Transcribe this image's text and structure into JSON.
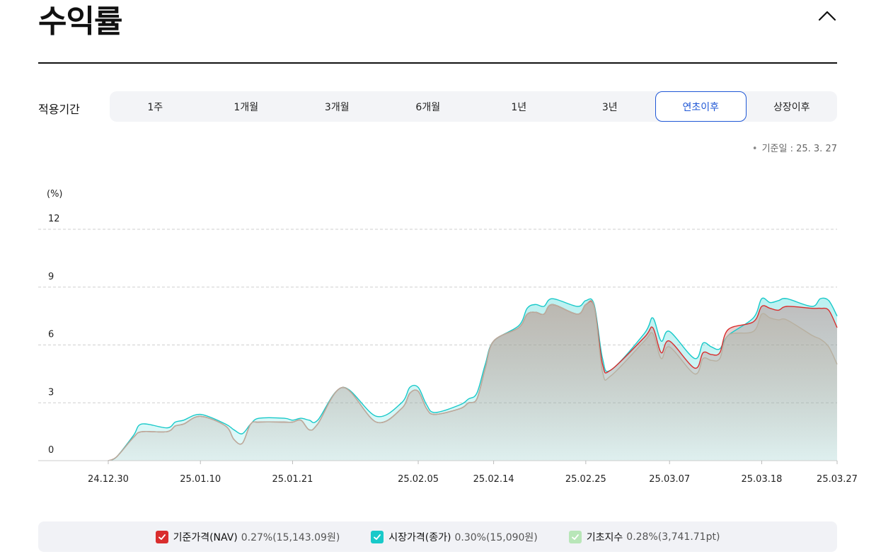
{
  "header": {
    "title": "수익률"
  },
  "period": {
    "label": "적용기간",
    "tabs": [
      "1주",
      "1개월",
      "3개월",
      "6개월",
      "1년",
      "3년",
      "연초이후",
      "상장이후"
    ],
    "active": "연초이후"
  },
  "base_date": "기준일 : 25. 3. 27",
  "colors": {
    "nav": "#d92d2d",
    "market": "#18c9c9",
    "index": "#b8e6b8",
    "active_tab": "#1f57d6"
  },
  "chart_data": {
    "type": "area",
    "ylabel": "(%)",
    "ylim": [
      0,
      12
    ],
    "yticks": [
      0,
      3,
      6,
      9,
      12
    ],
    "xlim": [
      "24.12.30",
      "25.03.27"
    ],
    "x_tick_labels": [
      "24.12.30",
      "25.01.10",
      "25.01.21",
      "25.02.05",
      "25.02.14",
      "25.02.25",
      "25.03.07",
      "25.03.18",
      "25.03.27"
    ],
    "grid": true,
    "series": [
      {
        "name": "기준가격(NAV)",
        "color": "#d92d2d",
        "points": [
          [
            "24.12.30",
            0
          ],
          [
            "24.12.31",
            0.2
          ],
          [
            "25.01.02",
            1.2
          ],
          [
            "25.01.03",
            1.5
          ],
          [
            "25.01.06",
            1.5
          ],
          [
            "25.01.07",
            1.8
          ],
          [
            "25.01.08",
            1.9
          ],
          [
            "25.01.10",
            2.3
          ],
          [
            "25.01.13",
            1.8
          ],
          [
            "25.01.14",
            1.1
          ],
          [
            "25.01.15",
            0.9
          ],
          [
            "25.01.16",
            1.9
          ],
          [
            "25.01.17",
            2.0
          ],
          [
            "25.01.20",
            2.0
          ],
          [
            "25.01.21",
            2.0
          ],
          [
            "25.01.22",
            2.1
          ],
          [
            "25.01.23",
            1.6
          ],
          [
            "25.01.24",
            1.9
          ],
          [
            "25.01.27",
            3.8
          ],
          [
            "25.01.31",
            2.0
          ],
          [
            "25.02.03",
            2.7
          ],
          [
            "25.02.04",
            3.5
          ],
          [
            "25.02.05",
            3.6
          ],
          [
            "25.02.06",
            2.7
          ],
          [
            "25.02.07",
            2.4
          ],
          [
            "25.02.10",
            2.7
          ],
          [
            "25.02.11",
            3.0
          ],
          [
            "25.02.12",
            3.2
          ],
          [
            "25.02.13",
            4.8
          ],
          [
            "25.02.14",
            6.2
          ],
          [
            "25.02.17",
            6.9
          ],
          [
            "25.02.18",
            7.6
          ],
          [
            "25.02.19",
            7.7
          ],
          [
            "25.02.20",
            7.6
          ],
          [
            "25.02.21",
            8.1
          ],
          [
            "25.02.24",
            7.6
          ],
          [
            "25.02.25",
            8.1
          ],
          [
            "25.02.26",
            8.0
          ],
          [
            "25.02.27",
            5.0
          ],
          [
            "25.02.28",
            4.7
          ],
          [
            "25.03.04",
            6.4
          ],
          [
            "25.03.05",
            6.9
          ],
          [
            "25.03.06",
            5.6
          ],
          [
            "25.03.07",
            6.2
          ],
          [
            "25.03.10",
            4.8
          ],
          [
            "25.03.11",
            5.6
          ],
          [
            "25.03.12",
            5.5
          ],
          [
            "25.03.13",
            5.6
          ],
          [
            "25.03.14",
            6.8
          ],
          [
            "25.03.17",
            7.2
          ],
          [
            "25.03.18",
            8.0
          ],
          [
            "25.03.19",
            7.9
          ],
          [
            "25.03.20",
            7.8
          ],
          [
            "25.03.21",
            8.0
          ],
          [
            "25.03.24",
            7.9
          ],
          [
            "25.03.25",
            7.9
          ],
          [
            "25.03.26",
            7.8
          ],
          [
            "25.03.27",
            6.9
          ]
        ]
      },
      {
        "name": "시장가격(종가)",
        "color": "#18c9c9",
        "points": [
          [
            "24.12.30",
            0
          ],
          [
            "24.12.31",
            0.2
          ],
          [
            "25.01.02",
            1.3
          ],
          [
            "25.01.03",
            1.9
          ],
          [
            "25.01.06",
            1.7
          ],
          [
            "25.01.07",
            2.0
          ],
          [
            "25.01.08",
            2.1
          ],
          [
            "25.01.10",
            2.4
          ],
          [
            "25.01.13",
            1.9
          ],
          [
            "25.01.14",
            1.6
          ],
          [
            "25.01.15",
            1.4
          ],
          [
            "25.01.16",
            1.9
          ],
          [
            "25.01.17",
            2.2
          ],
          [
            "25.01.20",
            2.2
          ],
          [
            "25.01.21",
            2.1
          ],
          [
            "25.01.22",
            2.2
          ],
          [
            "25.01.23",
            2.1
          ],
          [
            "25.01.24",
            2.1
          ],
          [
            "25.01.27",
            3.8
          ],
          [
            "25.01.31",
            2.3
          ],
          [
            "25.02.03",
            3.0
          ],
          [
            "25.02.04",
            3.8
          ],
          [
            "25.02.05",
            3.8
          ],
          [
            "25.02.06",
            2.9
          ],
          [
            "25.02.07",
            2.5
          ],
          [
            "25.02.10",
            2.9
          ],
          [
            "25.02.11",
            3.2
          ],
          [
            "25.02.12",
            3.5
          ],
          [
            "25.02.13",
            5.0
          ],
          [
            "25.02.14",
            6.2
          ],
          [
            "25.02.17",
            7.0
          ],
          [
            "25.02.18",
            7.9
          ],
          [
            "25.02.19",
            8.1
          ],
          [
            "25.02.20",
            8.0
          ],
          [
            "25.02.21",
            8.4
          ],
          [
            "25.02.24",
            8.0
          ],
          [
            "25.02.25",
            8.3
          ],
          [
            "25.02.26",
            8.1
          ],
          [
            "25.02.27",
            5.3
          ],
          [
            "25.02.28",
            4.7
          ],
          [
            "25.03.04",
            6.6
          ],
          [
            "25.03.05",
            7.4
          ],
          [
            "25.03.06",
            6.2
          ],
          [
            "25.03.07",
            6.7
          ],
          [
            "25.03.10",
            5.3
          ],
          [
            "25.03.11",
            6.1
          ],
          [
            "25.03.12",
            5.9
          ],
          [
            "25.03.13",
            5.8
          ],
          [
            "25.03.14",
            6.5
          ],
          [
            "25.03.17",
            7.4
          ],
          [
            "25.03.18",
            8.4
          ],
          [
            "25.03.19",
            8.2
          ],
          [
            "25.03.20",
            8.3
          ],
          [
            "25.03.21",
            8.4
          ],
          [
            "25.03.24",
            8.0
          ],
          [
            "25.03.25",
            8.4
          ],
          [
            "25.03.26",
            8.3
          ],
          [
            "25.03.27",
            7.5
          ]
        ]
      },
      {
        "name": "기초지수",
        "color": "#b8e6b8",
        "points": [
          [
            "24.12.30",
            0
          ],
          [
            "24.12.31",
            0.2
          ],
          [
            "25.01.02",
            1.2
          ],
          [
            "25.01.03",
            1.5
          ],
          [
            "25.01.06",
            1.5
          ],
          [
            "25.01.07",
            1.8
          ],
          [
            "25.01.08",
            1.9
          ],
          [
            "25.01.10",
            2.3
          ],
          [
            "25.01.13",
            1.8
          ],
          [
            "25.01.14",
            1.1
          ],
          [
            "25.01.15",
            0.9
          ],
          [
            "25.01.16",
            1.9
          ],
          [
            "25.01.17",
            2.0
          ],
          [
            "25.01.20",
            2.0
          ],
          [
            "25.01.21",
            2.0
          ],
          [
            "25.01.22",
            2.1
          ],
          [
            "25.01.23",
            1.6
          ],
          [
            "25.01.24",
            1.9
          ],
          [
            "25.01.27",
            3.8
          ],
          [
            "25.01.31",
            2.0
          ],
          [
            "25.02.03",
            2.7
          ],
          [
            "25.02.04",
            3.5
          ],
          [
            "25.02.05",
            3.6
          ],
          [
            "25.02.06",
            2.7
          ],
          [
            "25.02.07",
            2.4
          ],
          [
            "25.02.10",
            2.7
          ],
          [
            "25.02.11",
            3.0
          ],
          [
            "25.02.12",
            3.2
          ],
          [
            "25.02.13",
            4.8
          ],
          [
            "25.02.14",
            6.2
          ],
          [
            "25.02.17",
            6.9
          ],
          [
            "25.02.18",
            7.6
          ],
          [
            "25.02.19",
            7.7
          ],
          [
            "25.02.20",
            7.6
          ],
          [
            "25.02.21",
            8.1
          ],
          [
            "25.02.24",
            7.6
          ],
          [
            "25.02.25",
            8.1
          ],
          [
            "25.02.26",
            8.0
          ],
          [
            "25.02.27",
            4.6
          ],
          [
            "25.02.28",
            4.4
          ],
          [
            "25.03.04",
            6.2
          ],
          [
            "25.03.05",
            6.6
          ],
          [
            "25.03.06",
            5.3
          ],
          [
            "25.03.07",
            5.9
          ],
          [
            "25.03.10",
            4.5
          ],
          [
            "25.03.11",
            5.3
          ],
          [
            "25.03.12",
            5.2
          ],
          [
            "25.03.13",
            5.3
          ],
          [
            "25.03.14",
            6.5
          ],
          [
            "25.03.17",
            6.7
          ],
          [
            "25.03.18",
            7.6
          ],
          [
            "25.03.19",
            7.4
          ],
          [
            "25.03.20",
            7.3
          ],
          [
            "25.03.21",
            7.3
          ],
          [
            "25.03.24",
            6.5
          ],
          [
            "25.03.25",
            6.3
          ],
          [
            "25.03.26",
            5.9
          ],
          [
            "25.03.27",
            5.0
          ]
        ]
      }
    ]
  },
  "legend": [
    {
      "name": "기준가격(NAV)",
      "value": "0.27%(15,143.09원)",
      "color": "#d92d2d"
    },
    {
      "name": "시장가격(종가)",
      "value": "0.30%(15,090원)",
      "color": "#18c9c9"
    },
    {
      "name": "기초지수",
      "value": "0.28%(3,741.71pt)",
      "color": "#b8e6b8"
    }
  ]
}
